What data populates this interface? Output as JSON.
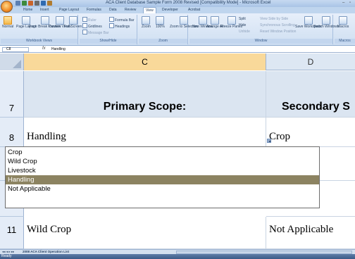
{
  "window": {
    "title": "ACA Client Database Sample Form 2008 Revised [Compatibility Mode] - Microsoft Excel"
  },
  "ribbon": {
    "tabs": [
      "Home",
      "Insert",
      "Page Layout",
      "Formulas",
      "Data",
      "Review",
      "View",
      "Developer",
      "Acrobat"
    ],
    "active_tab": "View",
    "groups": {
      "workbook_views": {
        "label": "Workbook Views",
        "buttons": [
          "Normal",
          "Page Layout",
          "Page Break Preview",
          "Custom Views",
          "Full Screen"
        ]
      },
      "show_hide": {
        "label": "Show/Hide",
        "options": [
          "Ruler",
          "Gridlines",
          "Message Bar",
          "Formula Bar",
          "Headings"
        ]
      },
      "zoom": {
        "label": "Zoom",
        "buttons": [
          "Zoom",
          "100%",
          "Zoom to Selection"
        ]
      },
      "window": {
        "label": "Window",
        "buttons": [
          "New Window",
          "Arrange All",
          "Freeze Panes",
          "Split",
          "Hide",
          "Unhide",
          "View Side by Side",
          "Synchronous Scrolling",
          "Reset Window Position",
          "Save Workspace",
          "Switch Windows"
        ]
      },
      "macros": {
        "label": "Macros",
        "buttons": [
          "Macros"
        ]
      }
    }
  },
  "formula_bar": {
    "name_box": "C8",
    "fx": "fx",
    "value": "Handling"
  },
  "sheet": {
    "columns": [
      {
        "letter": "C",
        "selected": true
      },
      {
        "letter": "D",
        "selected": false
      }
    ],
    "rows": [
      {
        "number": "7",
        "c": "Primary Scope:",
        "d": "Secondary S"
      },
      {
        "number": "8",
        "c": "Handling",
        "d": "Crop"
      },
      {
        "number": "11",
        "c": "Wild Crop",
        "d": "Not Applicable"
      }
    ]
  },
  "dropdown": {
    "items": [
      "Crop",
      "Wild Crop",
      "Livestock",
      "Handling",
      "Not Applicable"
    ],
    "selected_index": 3
  },
  "sheet_tabs": {
    "active": "2008 ACA Client Operation List"
  },
  "status": {
    "text": "Ready"
  },
  "colors": {
    "selection": "#8c8361",
    "header_fill": "#dbe5f1",
    "selected_column": "#f9d99a"
  }
}
